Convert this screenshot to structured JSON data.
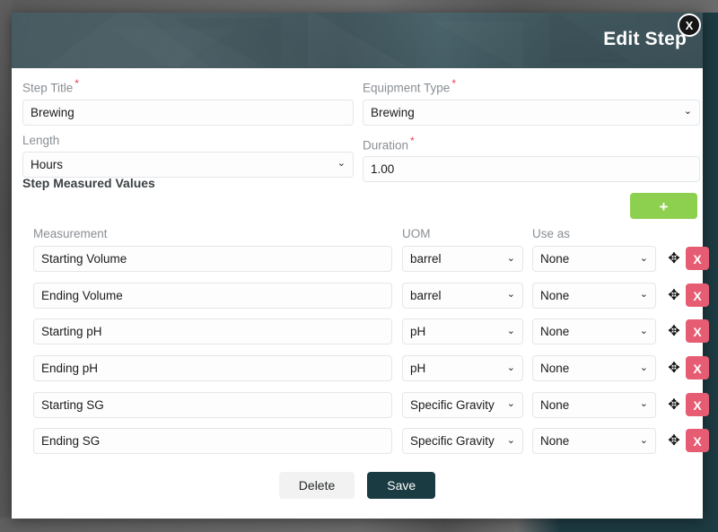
{
  "modal": {
    "title": "Edit Step",
    "close_label": "X",
    "close_icon": "close-icon"
  },
  "form": {
    "step_title": {
      "label": "Step Title",
      "required_marker": "*",
      "value": "Brewing"
    },
    "equipment_type": {
      "label": "Equipment Type",
      "required_marker": "*",
      "value": "Brewing",
      "chevron": "⌄"
    },
    "length": {
      "label": "Length",
      "required_marker": "",
      "value": "Hours",
      "chevron": "⌄"
    },
    "duration": {
      "label": "Duration",
      "required_marker": "*",
      "value": "1.00"
    }
  },
  "measured_values": {
    "section_title": "Step Measured Values",
    "add_label": "+",
    "headers": {
      "measurement": "Measurement",
      "uom": "UOM",
      "use_as": "Use as"
    },
    "move_icon": "✥",
    "delete_label": "X",
    "chevron": "⌄",
    "rows": [
      {
        "measurement": "Starting Volume",
        "uom": "barrel",
        "use_as": "None"
      },
      {
        "measurement": "Ending Volume",
        "uom": "barrel",
        "use_as": "None"
      },
      {
        "measurement": "Starting pH",
        "uom": "pH",
        "use_as": "None"
      },
      {
        "measurement": "Ending pH",
        "uom": "pH",
        "use_as": "None"
      },
      {
        "measurement": "Starting SG",
        "uom": "Specific Gravity",
        "use_as": "None"
      },
      {
        "measurement": "Ending SG",
        "uom": "Specific Gravity",
        "use_as": "None"
      }
    ]
  },
  "footer": {
    "delete_label": "Delete",
    "save_label": "Save"
  },
  "colors": {
    "header_bg": "#3a5159",
    "save_bg": "#1b3b42",
    "add_bg": "#8dd04f",
    "delete_row_bg": "#e65c72",
    "required_marker": "#e8415b",
    "label_text": "#8a8f94"
  }
}
